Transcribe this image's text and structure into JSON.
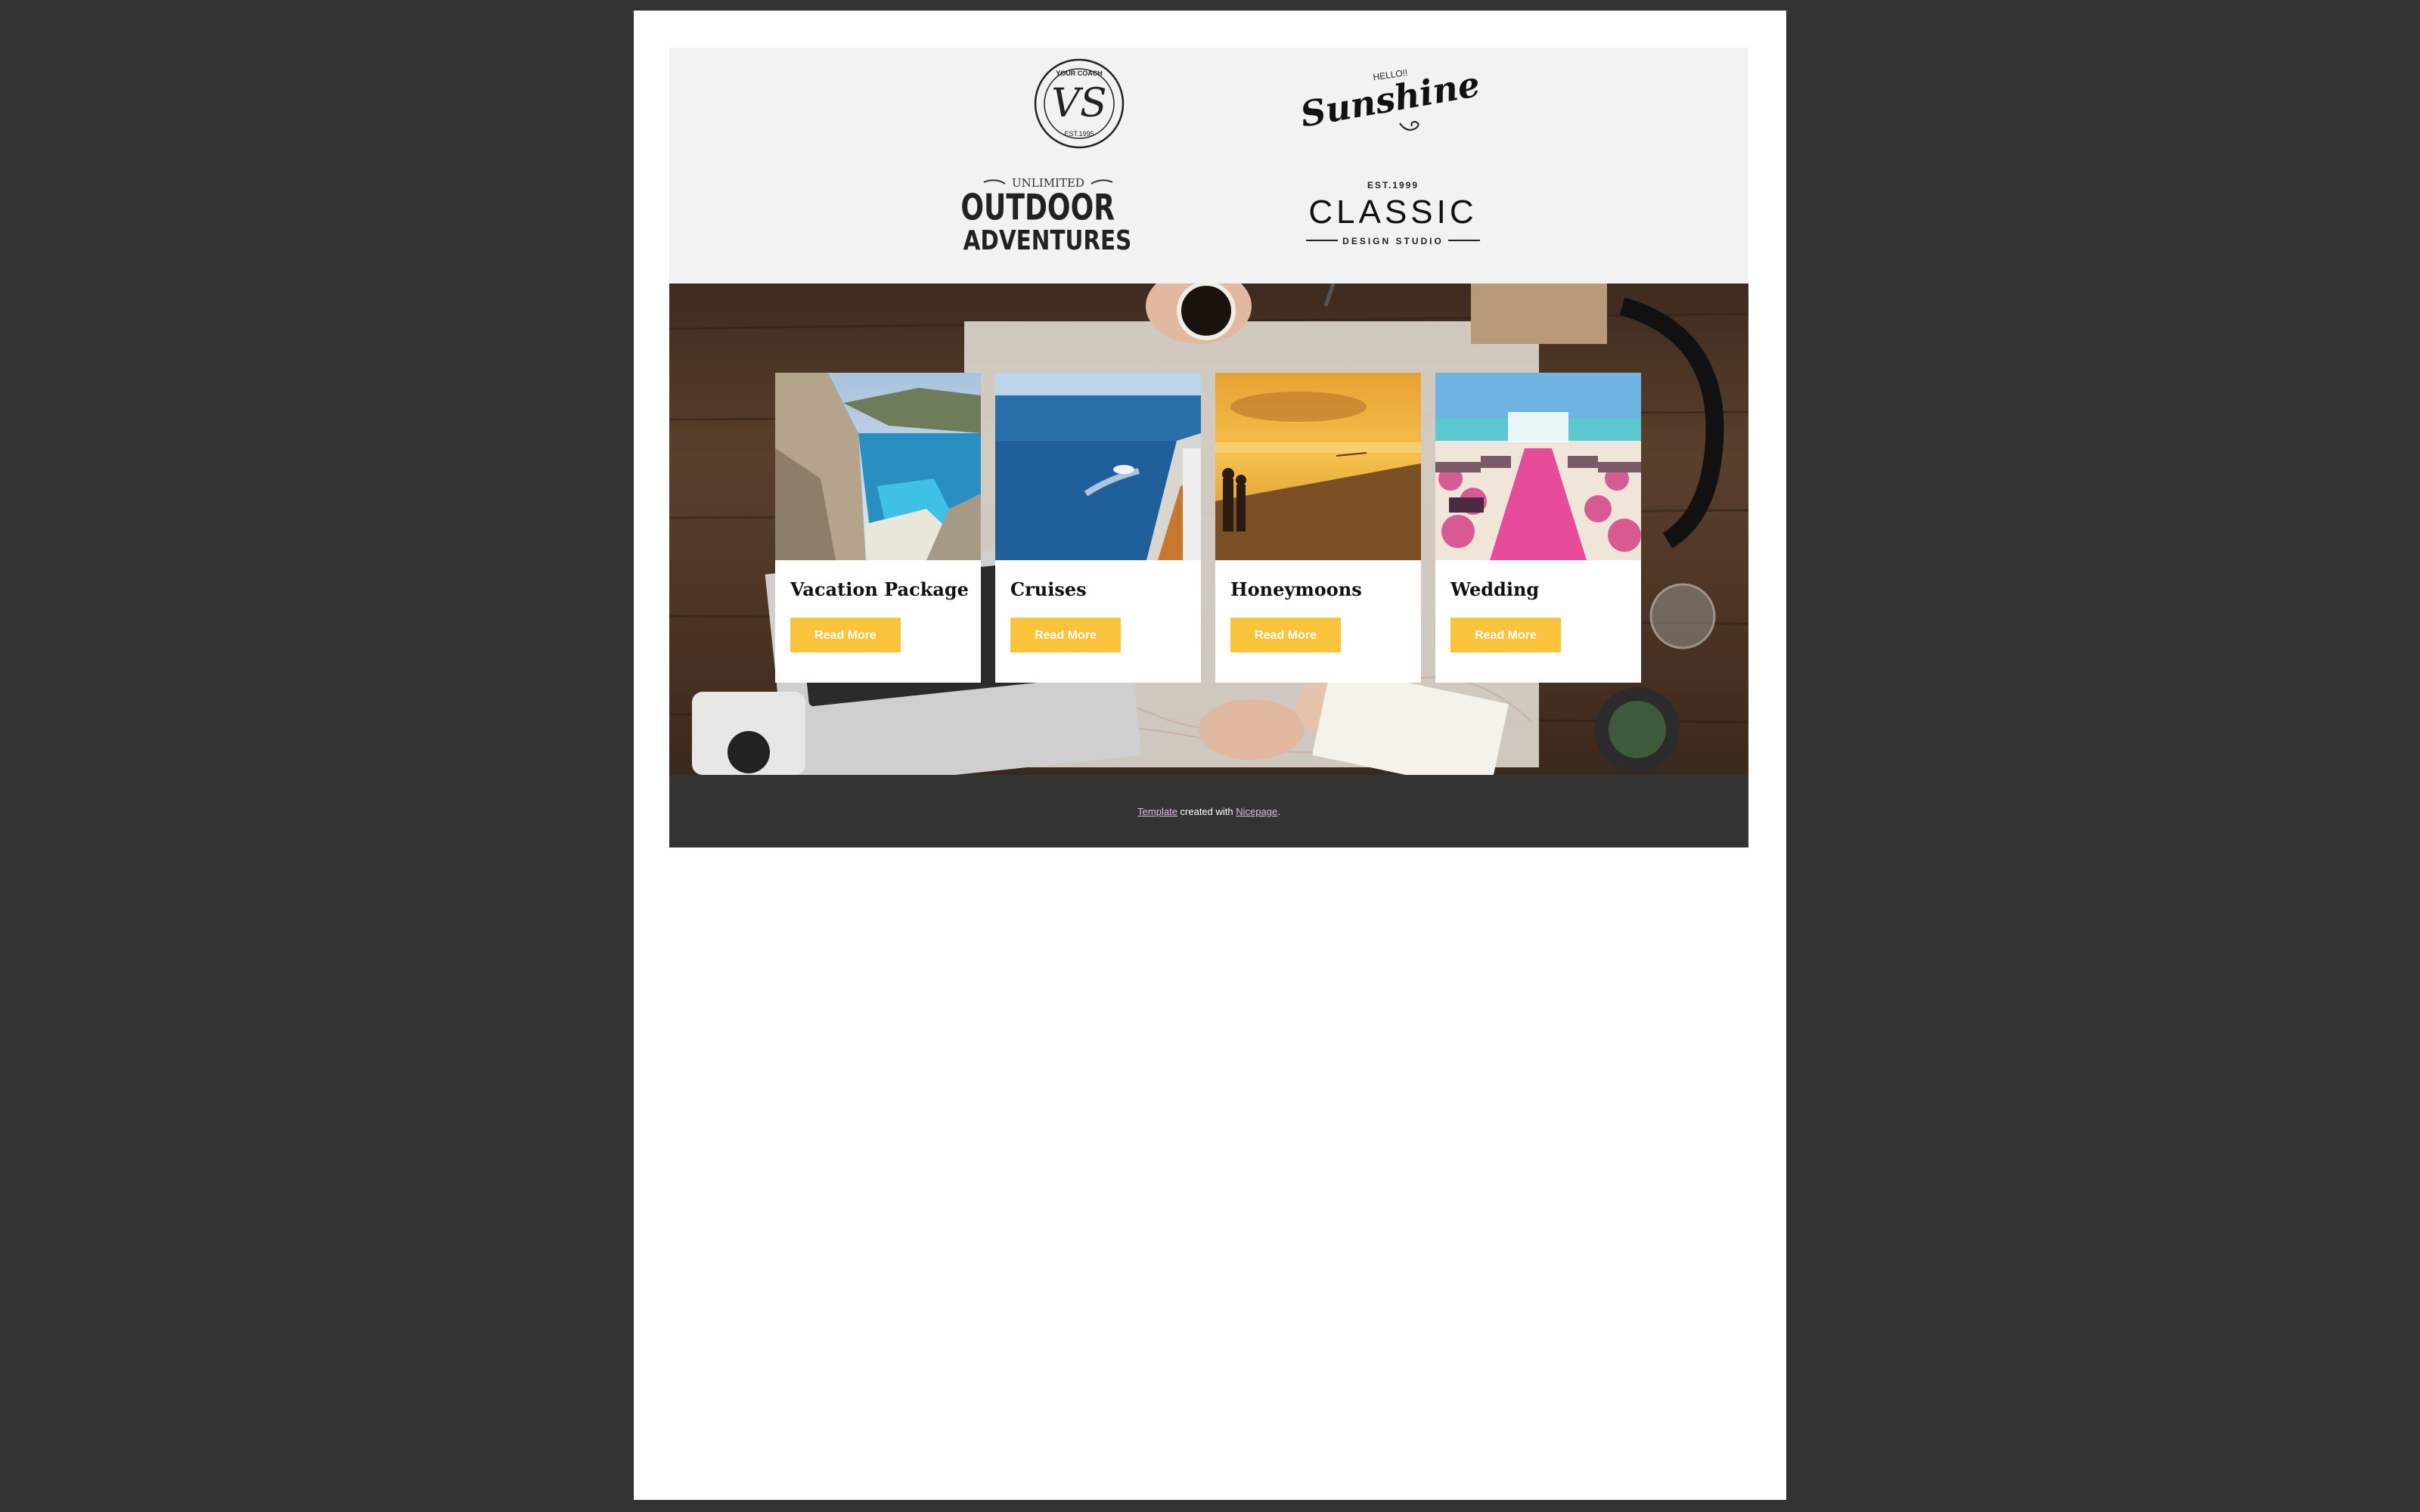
{
  "logos": [
    {
      "name": "vs-coach-logo",
      "lines": [
        "YOUR COACH",
        "VS",
        "EST.1995"
      ]
    },
    {
      "name": "sunshine-logo",
      "lines": [
        "HELLO!!",
        "Sunshine"
      ]
    },
    {
      "name": "outdoor-adventures-logo",
      "lines": [
        "UNLIMITED",
        "OUTDOOR",
        "ADVENTURES"
      ]
    },
    {
      "name": "classic-design-studio-logo",
      "lines": [
        "EST.1999",
        "CLASSIC",
        "DESIGN STUDIO"
      ]
    }
  ],
  "cards": [
    {
      "title": "Vacation Package",
      "button": "Read More",
      "image": "cliff-beach-photo"
    },
    {
      "title": "Cruises",
      "button": "Read More",
      "image": "cruise-ship-sea-photo"
    },
    {
      "title": "Honeymoons",
      "button": "Read More",
      "image": "couple-sunset-beach-photo"
    },
    {
      "title": "Wedding",
      "button": "Read More",
      "image": "beach-wedding-aisle-photo"
    }
  ],
  "footer": {
    "link1": "Template",
    "middle": " created with ",
    "link2": "Nicepage",
    "end": "."
  },
  "colors": {
    "page_bg": "#333333",
    "content_bg": "#ffffff",
    "logo_strip_bg": "#f2f2f2",
    "button": "#f9c33c",
    "footer_bg": "#333333",
    "footer_link": "#e2b9e8"
  }
}
